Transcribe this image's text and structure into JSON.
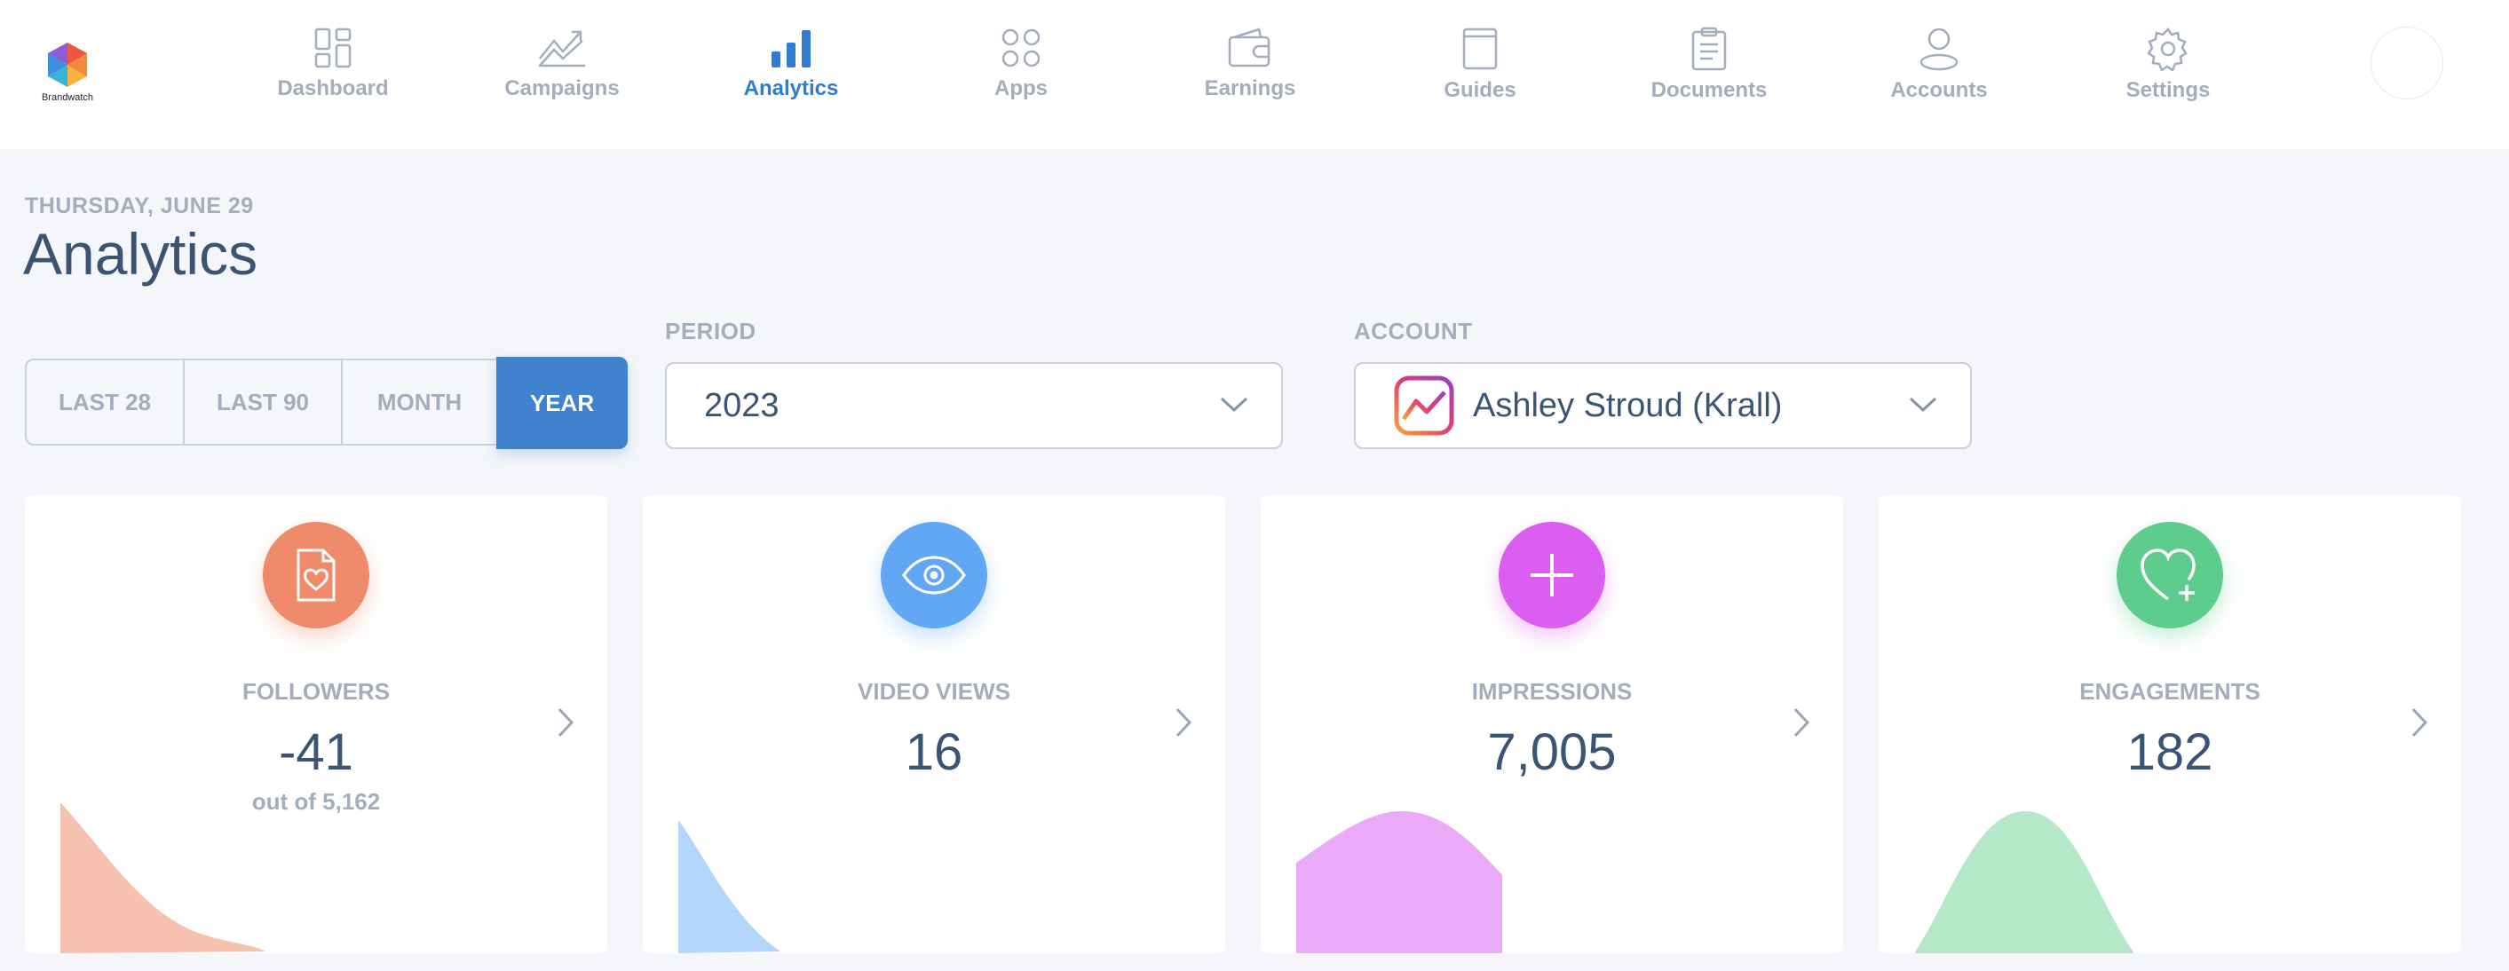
{
  "brand": {
    "logo_text": "Brandwatch"
  },
  "nav": {
    "items": [
      {
        "label": "Dashboard",
        "icon": "dashboard-icon"
      },
      {
        "label": "Campaigns",
        "icon": "trend-chart-icon"
      },
      {
        "label": "Analytics",
        "icon": "bar-chart-icon",
        "active": true
      },
      {
        "label": "Apps",
        "icon": "apps-grid-icon"
      },
      {
        "label": "Earnings",
        "icon": "wallet-icon"
      },
      {
        "label": "Guides",
        "icon": "book-icon"
      },
      {
        "label": "Documents",
        "icon": "clipboard-icon"
      },
      {
        "label": "Accounts",
        "icon": "user-icon"
      },
      {
        "label": "Settings",
        "icon": "gear-icon"
      }
    ]
  },
  "header": {
    "date": "THURSDAY, JUNE 29",
    "title": "Analytics"
  },
  "range_toggle": {
    "options": [
      "LAST 28",
      "LAST 90",
      "MONTH",
      "YEAR"
    ],
    "selected": "YEAR"
  },
  "period": {
    "label": "PERIOD",
    "value": "2023"
  },
  "account": {
    "label": "ACCOUNT",
    "value": "Ashley Stroud (Krall)",
    "icon": "instagram-chart-icon"
  },
  "cards": [
    {
      "label": "FOLLOWERS",
      "value": "-41",
      "sub": "out of 5,162",
      "color": "#ef8a6a",
      "spark_color": "#f6c1ae",
      "icon": "document-heart-icon"
    },
    {
      "label": "VIDEO VIEWS",
      "value": "16",
      "sub": "",
      "color": "#62a7f4",
      "spark_color": "#b5d6fb",
      "icon": "eye-icon"
    },
    {
      "label": "IMPRESSIONS",
      "value": "7,005",
      "sub": "",
      "color": "#db5ef0",
      "spark_color": "#ebaaf7",
      "icon": "plus-icon"
    },
    {
      "label": "ENGAGEMENTS",
      "value": "182",
      "sub": "",
      "color": "#5dcc8c",
      "spark_color": "#b5e8c9",
      "icon": "heart-plus-icon"
    }
  ]
}
